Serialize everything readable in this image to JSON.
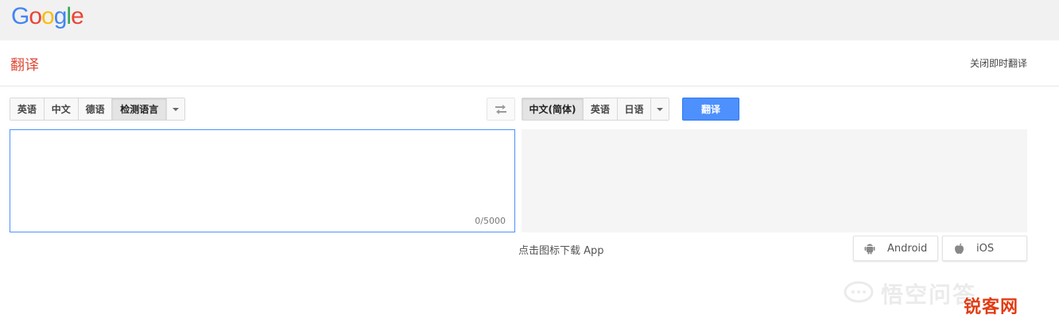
{
  "brand": {
    "logo_letters": [
      {
        "char": "G",
        "color": "#4285F4"
      },
      {
        "char": "o",
        "color": "#EA4335"
      },
      {
        "char": "o",
        "color": "#FBBC05"
      },
      {
        "char": "g",
        "color": "#4285F4"
      },
      {
        "char": "l",
        "color": "#34A853"
      },
      {
        "char": "e",
        "color": "#EA4335"
      }
    ]
  },
  "header": {
    "title": "翻译",
    "instant_toggle": "关闭即时翻译"
  },
  "source_langs": {
    "items": [
      "英语",
      "中文",
      "德语",
      "检测语言"
    ],
    "active_index": 3
  },
  "target_langs": {
    "items": [
      "中文(简体)",
      "英语",
      "日语"
    ],
    "active_index": 0
  },
  "actions": {
    "translate_label": "翻译",
    "swap_icon": "swap-arrows-icon"
  },
  "source": {
    "value": "",
    "char_count": "0/5000"
  },
  "result": {
    "value": ""
  },
  "apps": {
    "hint": "点击图标下载 App",
    "android_label": "Android",
    "ios_label": "iOS"
  },
  "watermark": {
    "text": "悟空问答",
    "stamp": "锐客网"
  },
  "colors": {
    "accent_red": "#dd4b39",
    "translate_blue": "#4d90fe"
  }
}
